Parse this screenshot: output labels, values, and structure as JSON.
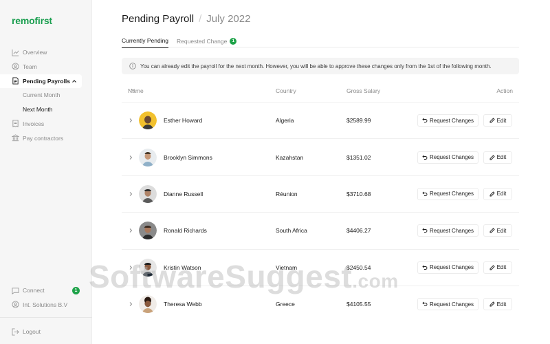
{
  "app": {
    "logo": "remofirst"
  },
  "sidebar": {
    "items": [
      {
        "label": "Overview",
        "icon": "chart-icon"
      },
      {
        "label": "Team",
        "icon": "user-icon"
      },
      {
        "label": "Pending Payrolls",
        "icon": "document-icon",
        "active": true
      },
      {
        "label": "Invoices",
        "icon": "invoice-icon"
      },
      {
        "label": "Pay contractors",
        "icon": "bank-icon"
      }
    ],
    "sub_items": [
      {
        "label": "Current Month"
      },
      {
        "label": "Next Month",
        "current": true
      }
    ],
    "bottom": [
      {
        "label": "Connect",
        "icon": "chat-icon",
        "badge": "1"
      },
      {
        "label": "Int. Solutions B.V",
        "icon": "user-icon"
      }
    ],
    "logout": {
      "label": "Logout",
      "icon": "logout-icon"
    }
  },
  "header": {
    "title": "Pending Payroll",
    "separator": "/",
    "period": "July 2022"
  },
  "tabs": [
    {
      "label": "Currently Pending",
      "active": true
    },
    {
      "label": "Requested Change",
      "count": "1"
    }
  ],
  "info_banner": {
    "text": "You can already edit the payroll for the next month. However, you will be able to approve these changes only from the 1st of the following month."
  },
  "table": {
    "columns": {
      "name": "Name",
      "country": "Country",
      "salary": "Gross Salary",
      "action": "Action"
    },
    "request_label": "Request Changes",
    "edit_label": "Edit",
    "rows": [
      {
        "name": "Esther Howard",
        "country": "Algeria",
        "salary": "$2589.99"
      },
      {
        "name": "Brooklyn Simmons",
        "country": "Kazahstan",
        "salary": "$1351.02"
      },
      {
        "name": "Dianne Russell",
        "country": "Réunion",
        "salary": "$3710.68"
      },
      {
        "name": "Ronald Richards",
        "country": "South Africa",
        "salary": "$4406.27"
      },
      {
        "name": "Kristin Watson",
        "country": "Vietnam",
        "salary": "$2450.54"
      },
      {
        "name": "Theresa Webb",
        "country": "Greece",
        "salary": "$4105.55"
      }
    ]
  },
  "watermark": {
    "text": "SoftwareSuggest",
    "suffix": ".com"
  },
  "colors": {
    "brand": "#1a9e4f",
    "badge": "#1fa34a"
  }
}
